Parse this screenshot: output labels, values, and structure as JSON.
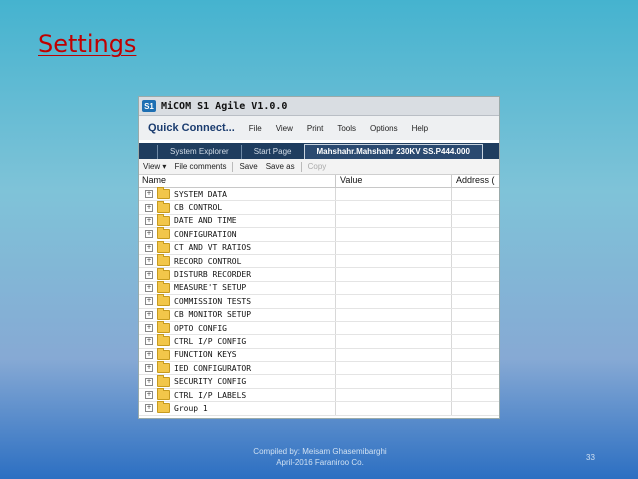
{
  "slide": {
    "title": "Settings",
    "footer_line1": "Compiled by: Meisam Ghasemibarghi",
    "footer_line2": "April-2016 Faraniroo Co.",
    "page_number": "33"
  },
  "window": {
    "icon_label": "S1",
    "title": "MiCOM S1 Agile V1.0.0"
  },
  "menu": {
    "quick_connect": "Quick Connect...",
    "items": [
      "File",
      "View",
      "Print",
      "Tools",
      "Options",
      "Help"
    ]
  },
  "tabs": [
    {
      "label": "System Explorer",
      "active": false
    },
    {
      "label": "Start Page",
      "active": false
    },
    {
      "label": "Mahshahr.Mahshahr 230KV SS.P444.000",
      "active": true
    }
  ],
  "toolbar": {
    "view_label": "View ▾",
    "file_comments_label": "File comments",
    "save_label": "Save",
    "save_as_label": "Save as",
    "copy_label": "Copy"
  },
  "table": {
    "headers": {
      "name": "Name",
      "value": "Value",
      "address": "Address ("
    },
    "rows": [
      "SYSTEM DATA",
      "CB CONTROL",
      "DATE AND TIME",
      "CONFIGURATION",
      "CT AND VT RATIOS",
      "RECORD CONTROL",
      "DISTURB RECORDER",
      "MEASURE'T SETUP",
      "COMMISSION TESTS",
      "CB MONITOR SETUP",
      "OPTO CONFIG",
      "CTRL I/P CONFIG",
      "FUNCTION KEYS",
      "IED CONFIGURATOR",
      "SECURITY CONFIG",
      "CTRL I/P LABELS",
      "Group 1"
    ]
  },
  "colors": {
    "title_red": "#c00000",
    "tab_bar": "#1f3d5f",
    "folder_yellow": "#f2c64a"
  }
}
